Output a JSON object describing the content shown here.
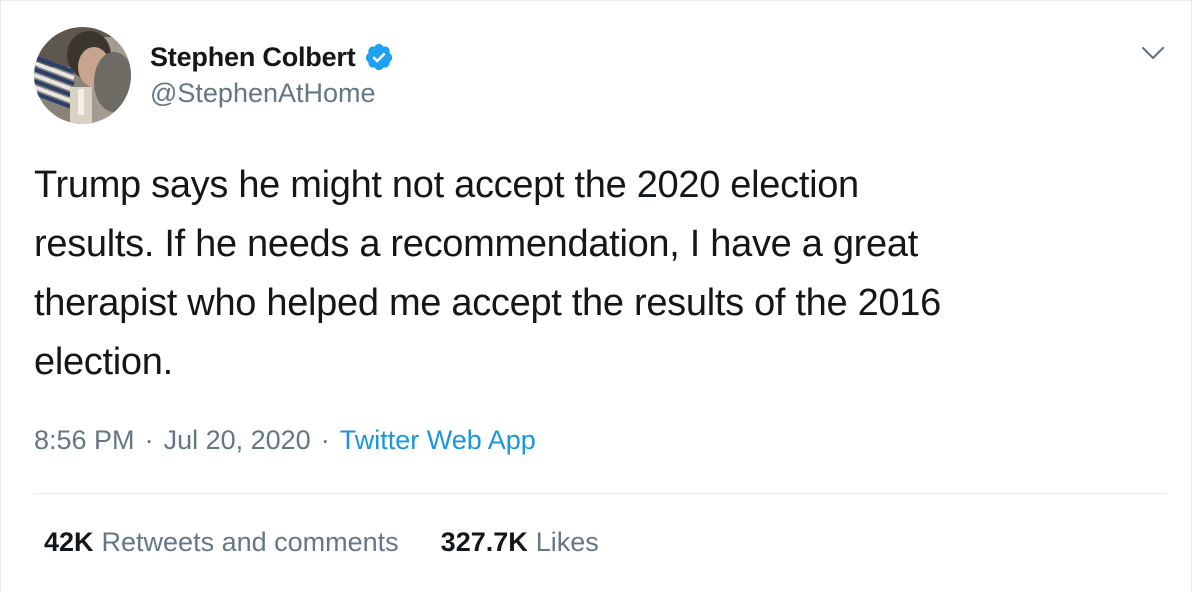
{
  "author": {
    "display_name": "Stephen Colbert",
    "handle": "@StephenAtHome",
    "verified": true,
    "avatar_icon": "profile-photo"
  },
  "tweet": {
    "text": "Trump says he might not accept the 2020 election\nresults. If he needs a recommendation, I have a great\ntherapist who helped me accept the results of the 2016\nelection.",
    "time": "8:56 PM",
    "separator": "·",
    "date": "Jul 20, 2020",
    "source": "Twitter Web App"
  },
  "stats": {
    "retweets_count": "42K",
    "retweets_label": "Retweets and comments",
    "likes_count": "327.7K",
    "likes_label": "Likes"
  },
  "colors": {
    "text_primary": "#14171a",
    "text_secondary": "#657786",
    "link": "#1b95e0",
    "verified_badge": "#1da1f2",
    "border": "#e6ecf0"
  },
  "icons": {
    "verified": "verified-badge-icon",
    "menu": "chevron-down-icon"
  }
}
